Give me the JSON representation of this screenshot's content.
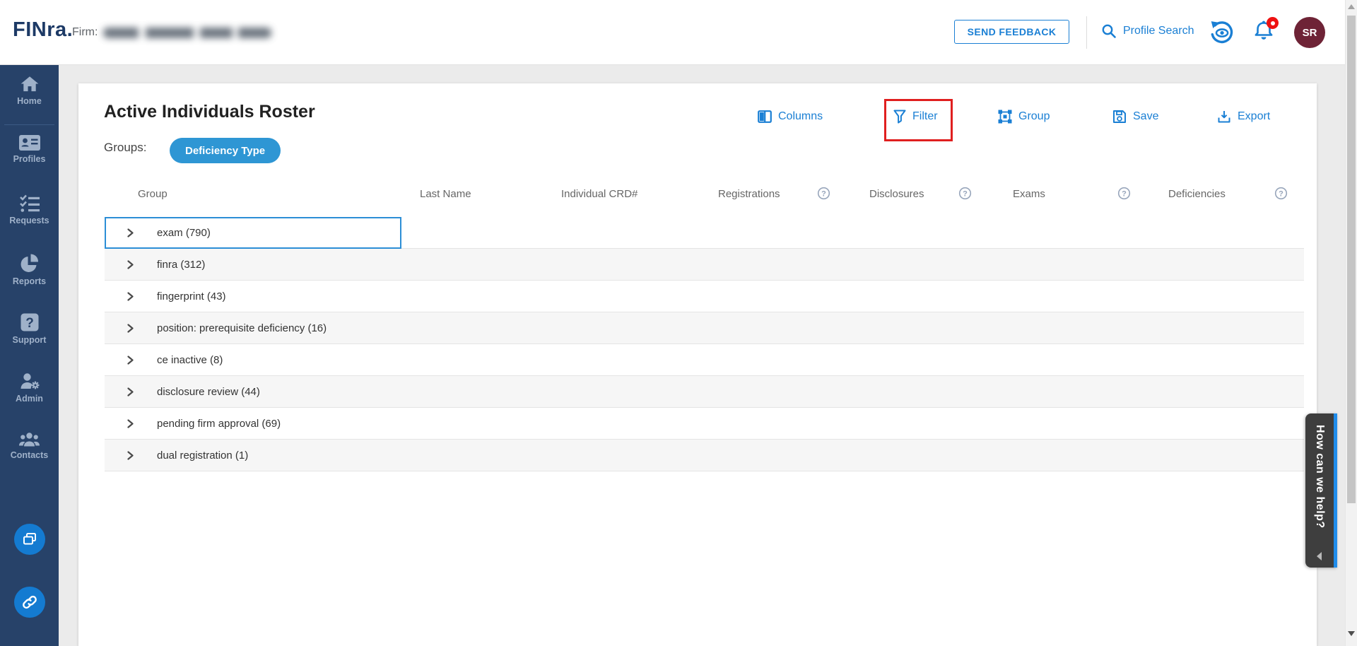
{
  "topbar": {
    "logo_text": "FINra.",
    "firm_label": "Firm:",
    "firm_name_redacted": true,
    "send_feedback_label": "SEND FEEDBACK",
    "profile_search_label": "Profile Search",
    "has_notification": true,
    "avatar_initials": "SR"
  },
  "sidebar": {
    "items": [
      {
        "label": "Home",
        "icon": "home-icon"
      },
      {
        "label": "Profiles",
        "icon": "id-card-icon"
      },
      {
        "label": "Requests",
        "icon": "checklist-icon"
      },
      {
        "label": "Reports",
        "icon": "pie-chart-icon"
      },
      {
        "label": "Support",
        "icon": "question-square-icon"
      },
      {
        "label": "Admin",
        "icon": "user-gear-icon"
      },
      {
        "label": "Contacts",
        "icon": "people-icon"
      }
    ],
    "floating_buttons": [
      {
        "icon": "windows-icon"
      },
      {
        "icon": "link-icon"
      }
    ]
  },
  "main": {
    "title": "Active Individuals Roster",
    "groups_label": "Groups:",
    "group_chips": [
      {
        "label": "Deficiency Type"
      }
    ],
    "toolbar": [
      {
        "label": "Columns",
        "icon": "columns-icon"
      },
      {
        "label": "Filter",
        "icon": "filter-icon",
        "annotated": true
      },
      {
        "label": "Group",
        "icon": "group-icon"
      },
      {
        "label": "Save",
        "icon": "save-icon"
      },
      {
        "label": "Export",
        "icon": "export-icon"
      }
    ],
    "table": {
      "headers": [
        {
          "label": "Group",
          "help": false
        },
        {
          "label": "Last Name",
          "help": false
        },
        {
          "label": "Individual CRD#",
          "help": false
        },
        {
          "label": "Registrations",
          "help": true
        },
        {
          "label": "Disclosures",
          "help": true
        },
        {
          "label": "Exams",
          "help": true
        },
        {
          "label": "Deficiencies",
          "help": true
        }
      ],
      "rows": [
        {
          "group": "exam",
          "count": 790,
          "display": "exam (790)",
          "selected": true
        },
        {
          "group": "finra",
          "count": 312,
          "display": "finra (312)",
          "selected": false
        },
        {
          "group": "fingerprint",
          "count": 43,
          "display": "fingerprint (43)",
          "selected": false
        },
        {
          "group": "position: prerequisite deficiency",
          "count": 16,
          "display": "position: prerequisite deficiency (16)",
          "selected": false
        },
        {
          "group": "ce inactive",
          "count": 8,
          "display": "ce inactive (8)",
          "selected": false
        },
        {
          "group": "disclosure review",
          "count": 44,
          "display": "disclosure review (44)",
          "selected": false
        },
        {
          "group": "pending firm approval",
          "count": 69,
          "display": "pending firm approval (69)",
          "selected": false
        },
        {
          "group": "dual registration",
          "count": 1,
          "display": "dual registration (1)",
          "selected": false
        }
      ]
    }
  },
  "help_tab": {
    "label": "How can we help?"
  },
  "annotation": {
    "type": "highlight-box",
    "target": "filter-button",
    "color": "#e01f1f"
  },
  "colors": {
    "accent_blue": "#1a7fd4",
    "chip_blue": "#2e96d4",
    "sidebar_navy": "#274269",
    "avatar_maroon": "#6e2336",
    "badge_red": "#ee1111"
  }
}
